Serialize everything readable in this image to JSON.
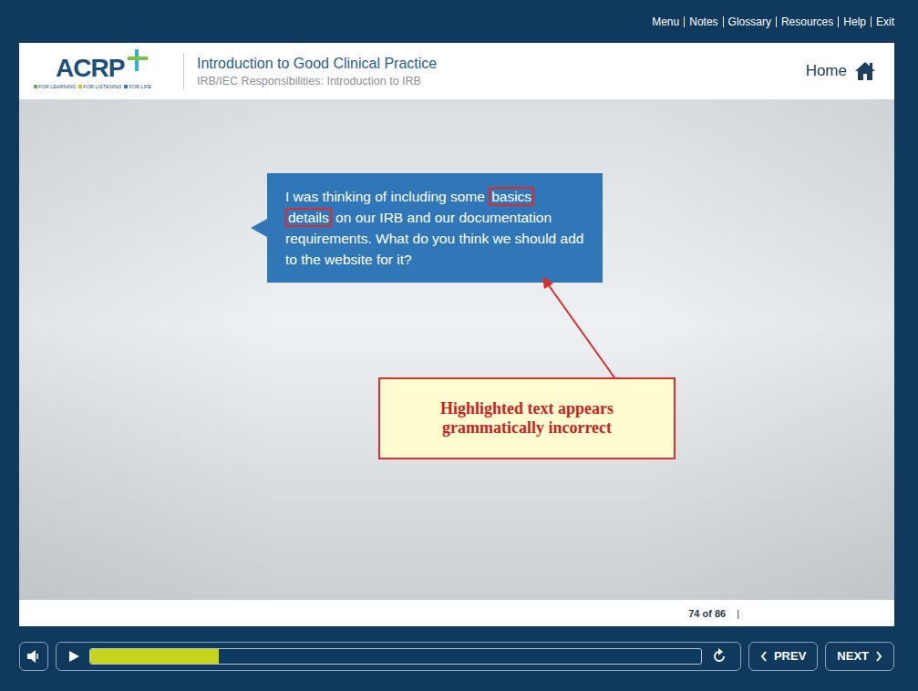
{
  "top_menu": [
    "Menu",
    "Notes",
    "Glossary",
    "Resources",
    "Help",
    "Exit"
  ],
  "header": {
    "logo": "ACRP",
    "logo_tagline": [
      {
        "label": "FOR LEARNING",
        "color": "#6ab04c"
      },
      {
        "label": "FOR LISTENING",
        "color": "#d4c21a"
      },
      {
        "label": "FOR LIFE",
        "color": "#2f7fc0"
      }
    ],
    "title": "Introduction to Good Clinical Practice",
    "subtitle": "IRB/IEC Responsibilities: Introduction to IRB",
    "home": "Home"
  },
  "slide": {
    "speech_bubble": [
      {
        "text": "I was thinking of including some ",
        "highlighted": false
      },
      {
        "text": "basics",
        "highlighted": true
      },
      {
        "text": " ",
        "highlighted": false
      },
      {
        "text": "details",
        "highlighted": true
      },
      {
        "text": " on our IRB and our documentation requirements. What do you think we should add to the website for it?",
        "highlighted": false
      }
    ],
    "annotation": "Highlighted text appears grammatically incorrect"
  },
  "page_counter": {
    "text": "74 of 86",
    "separator": "|"
  },
  "player": {
    "level": 0.21
  },
  "nav_buttons": [
    {
      "label": "PREV",
      "direction": "prev"
    },
    {
      "label": "NEXT",
      "direction": "next"
    }
  ]
}
